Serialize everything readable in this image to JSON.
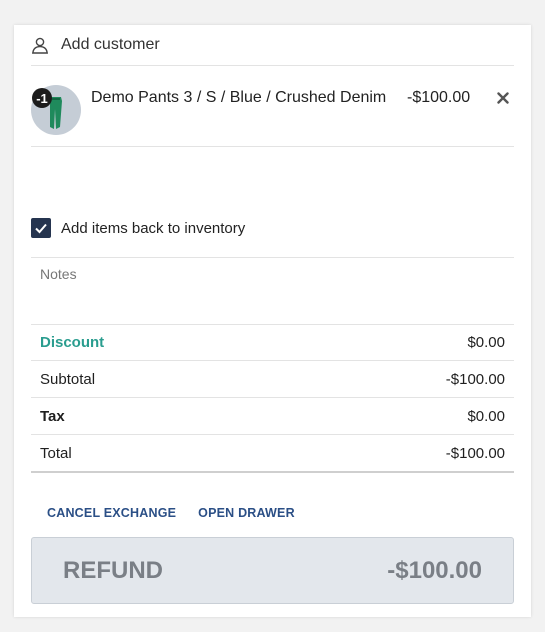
{
  "customer": {
    "label": "Add customer",
    "icon": "user-icon"
  },
  "line_item": {
    "quantity": "-1",
    "name": "Demo Pants 3 / S / Blue / Crushed Denim",
    "price": "-$100.00",
    "remove_icon": "close-icon",
    "thumbnail": "product-thumbnail"
  },
  "restock": {
    "label": "Add items back to inventory",
    "checked": true
  },
  "notes": {
    "placeholder": "Notes"
  },
  "totals": {
    "discount": {
      "label": "Discount",
      "value": "$0.00"
    },
    "subtotal": {
      "label": "Subtotal",
      "value": "-$100.00"
    },
    "tax": {
      "label": "Tax",
      "value": "$0.00"
    },
    "total": {
      "label": "Total",
      "value": "-$100.00"
    }
  },
  "actions": {
    "cancel_exchange": "CANCEL EXCHANGE",
    "open_drawer": "OPEN DRAWER"
  },
  "refund": {
    "label": "REFUND",
    "amount": "-$100.00"
  },
  "colors": {
    "accent_teal": "#2a9d8f",
    "link_blue": "#2b4f86",
    "checkbox_navy": "#25344f",
    "refund_bg": "#e3e7ec"
  }
}
